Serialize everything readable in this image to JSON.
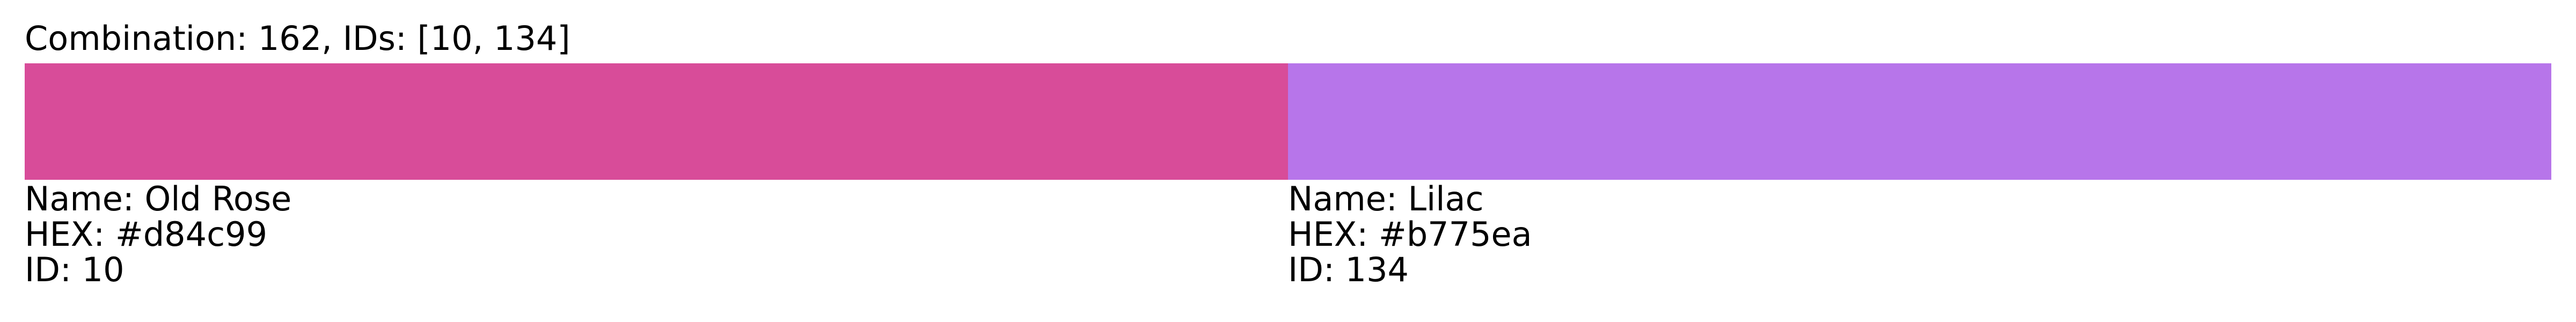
{
  "title": "Combination: 162, IDs: [10, 134]",
  "colors": [
    {
      "name_text": "Name: Old Rose",
      "hex_text": "HEX: #d84c99",
      "id_text": "ID: 10",
      "hex": "#d84c99"
    },
    {
      "name_text": "Name: Lilac",
      "hex_text": "HEX: #b775ea",
      "id_text": "ID: 134",
      "hex": "#b775ea"
    }
  ]
}
